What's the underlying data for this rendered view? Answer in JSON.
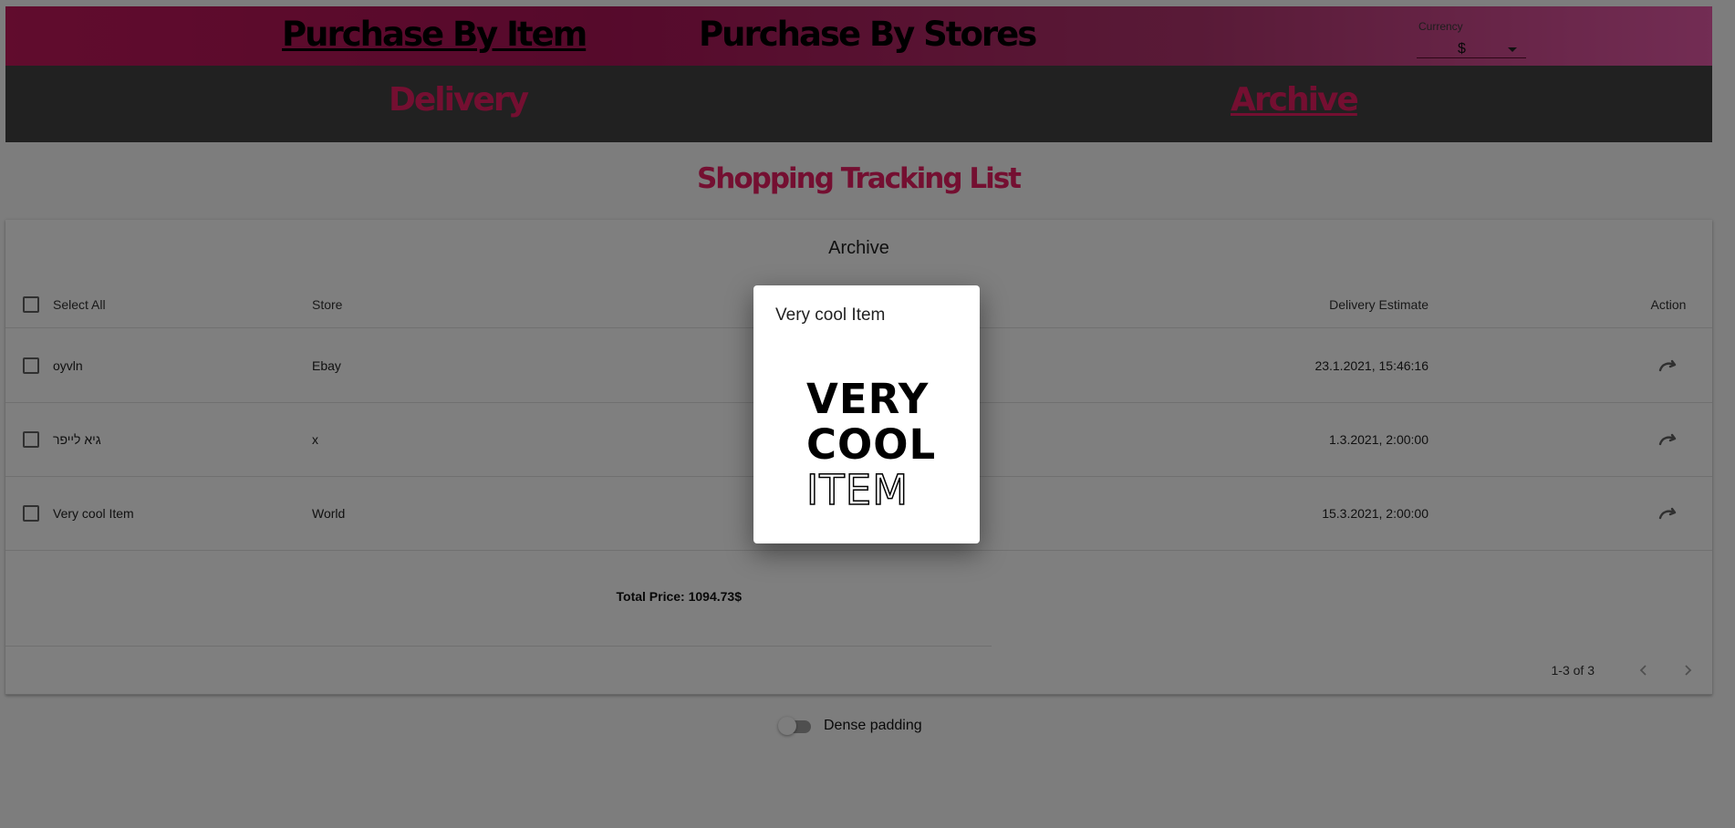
{
  "top_nav": {
    "purchase_by_item": "Purchase By Item",
    "purchase_by_stores": "Purchase By Stores",
    "currency": {
      "label": "Currency",
      "value": "$"
    }
  },
  "sub_nav": {
    "delivery": "Delivery",
    "archive": "Archive"
  },
  "main_title": "Shopping Tracking List",
  "table": {
    "title": "Archive",
    "columns": {
      "select_all": "Select All",
      "store": "Store",
      "delivery_estimate": "Delivery Estimate",
      "action": "Action"
    },
    "rows": [
      {
        "name": "oyvln",
        "store": "Ebay",
        "delivery_estimate": "23.1.2021, 15:46:16"
      },
      {
        "name": "גיא לייפר",
        "store": "x",
        "delivery_estimate": "1.3.2021, 2:00:00"
      },
      {
        "name": "Very cool Item",
        "store": "World",
        "delivery_estimate": "15.3.2021, 2:00:00"
      }
    ],
    "total_price": "Total Price: 1094.73$",
    "pagination": "1-3 of 3"
  },
  "dense_padding_label": "Dense padding",
  "modal": {
    "title": "Very cool Item",
    "image_text": [
      "VERY",
      "COOL",
      "ITEM"
    ]
  },
  "colors": {
    "accent_pink": "#e91e63",
    "sub_nav_bg": "#424242",
    "overlay": "rgba(0,0,0,0.5)"
  },
  "icons": {
    "row_action": "redo-icon",
    "pager_prev": "chevron-left-icon",
    "pager_next": "chevron-right-icon",
    "currency_dropdown": "caret-down-icon"
  }
}
